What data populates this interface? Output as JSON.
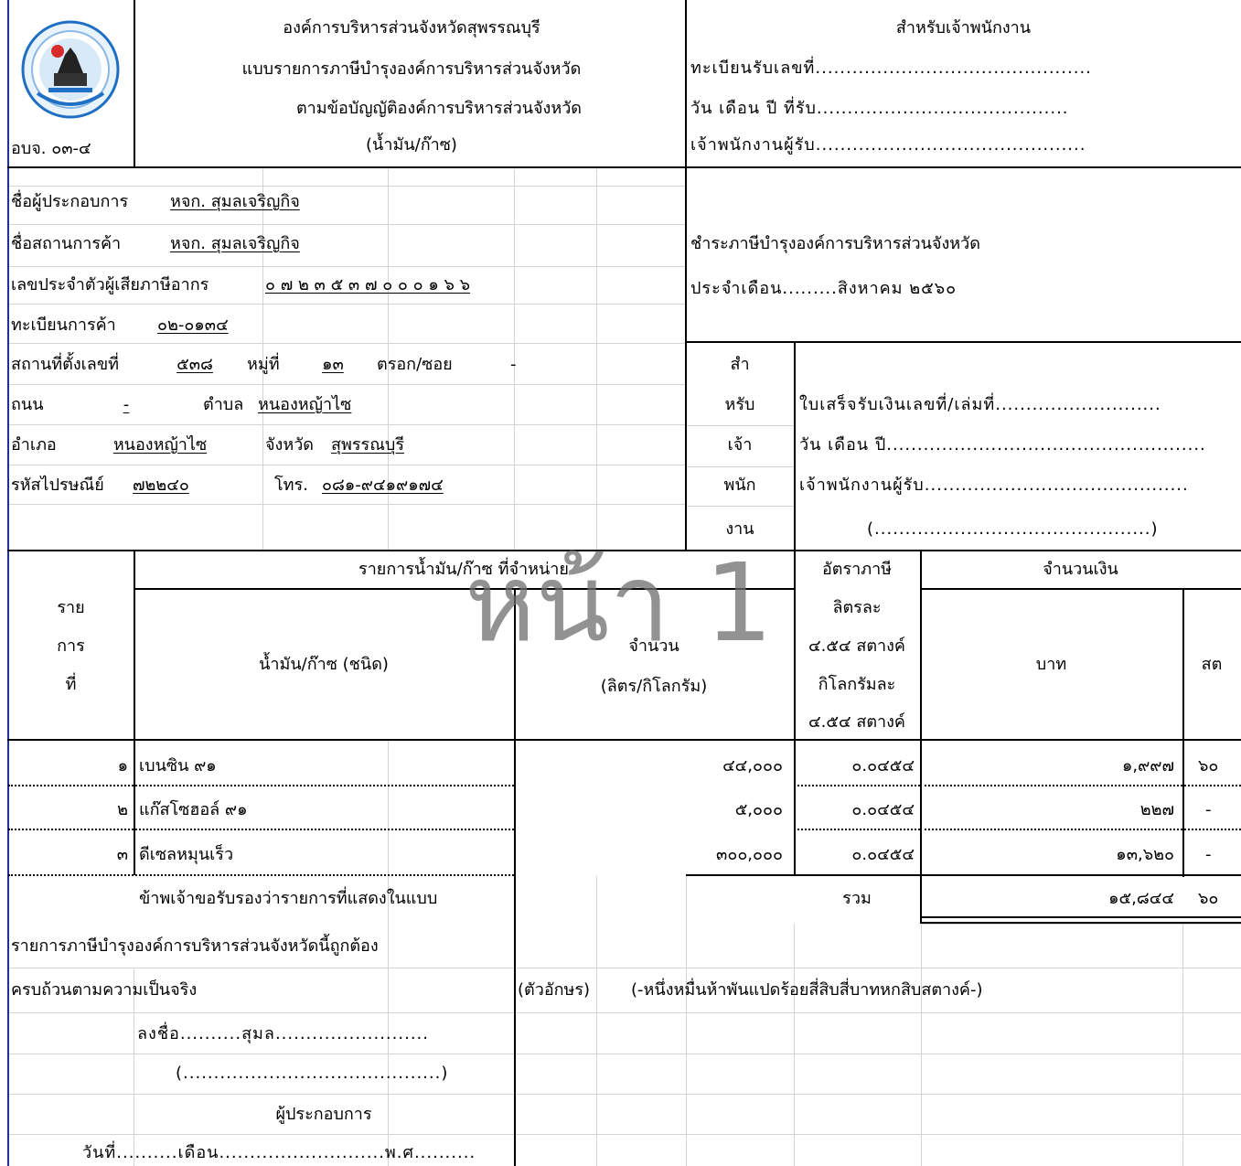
{
  "header": {
    "org_name": "องค์การบริหารส่วนจังหวัดสุพรรณบุรี",
    "form_title": "แบบรายการภาษีบำรุงองค์การบริหารส่วนจังหวัด",
    "form_subtitle": "ตามข้อบัญญัติองค์การบริหารส่วนจังหวัด",
    "form_type": "(น้ำมัน/ก๊าซ)",
    "form_code": "อบจ. ๐๓-๔"
  },
  "officer_box": {
    "title": "สำหรับเจ้าพนักงาน",
    "reg_no": "ทะเบียนรับเลขที่.............................................",
    "date_received": "วัน เดือน ปี ที่รับ.........................................",
    "officer": "เจ้าพนักงานผู้รับ............................................"
  },
  "operator": {
    "name_label": "ชื่อผู้ประกอบการ",
    "name_value": "หจก. สุมลเจริญกิจ",
    "shop_label": "ชื่อสถานการค้า",
    "shop_value": "หจก. สุมลเจริญกิจ",
    "tax_id_label": "เลขประจำตัวผู้เสียภาษีอากร",
    "tax_id_value": "๐ ๗ ๒ ๓ ๕ ๓ ๗ ๐ ๐ ๐ ๑ ๖ ๖",
    "trade_reg_label": "ทะเบียนการค้า",
    "trade_reg_value": "๐๒-๐๑๓๔",
    "address_no_label": "สถานที่ตั้งเลขที่",
    "address_no_value": "๕๓๘",
    "moo_label": "หมู่ที่",
    "moo_value": "๑๓",
    "soi_label": "ตรอก/ซอย",
    "soi_value": "-",
    "road_label": "ถนน",
    "road_value": "-",
    "tambon_label": "ตำบล",
    "tambon_value": "หนองหญ้าไซ",
    "amphoe_label": "อำเภอ",
    "amphoe_value": "หนองหญ้าไซ",
    "province_label": "จังหวัด",
    "province_value": "สุพรรณบุรี",
    "postcode_label": "รหัสไปรษณีย์",
    "postcode_value": "๗๒๒๔๐",
    "phone_label": "โทร.",
    "phone_value": "๐๘๑-๙๔๑๙๑๗๔"
  },
  "payment": {
    "line1": "ชำระภาษีบำรุงองค์การบริหารส่วนจังหวัด",
    "month_line": "ประจำเดือน.........สิงหาคม ๒๕๖๐"
  },
  "officer_side": {
    "vertical": [
      "สำ",
      "หรับ",
      "เจ้า",
      "พนัก",
      "งาน"
    ],
    "receipt": "ใบเสร็จรับเงินเลขที่/เล่มที่...........................",
    "date": "วัน เดือน ปี....................................................",
    "officer": "เจ้าพนักงานผู้รับ...........................................",
    "signature": "(.............................................)"
  },
  "table": {
    "group_header": "รายการน้ำมัน/ก๊าซ ที่จำหน่าย",
    "col_item": [
      "ราย",
      "การ",
      "ที่"
    ],
    "col_type": "น้ำมัน/ก๊าซ (ชนิด)",
    "col_qty": [
      "จำนวน",
      "(ลิตร/กิโลกรัม)"
    ],
    "col_rate": [
      "อัตราภาษี",
      "ลิตรละ",
      "๔.๕๔ สตางค์",
      "กิโลกรัมละ",
      "๔.๕๔ สตางค์"
    ],
    "col_amount": "จำนวนเงิน",
    "col_baht": "บาท",
    "col_satang": "สต",
    "rows": [
      {
        "no": "๑",
        "type": "เบนซิน ๙๑",
        "qty": "๔๔,๐๐๐",
        "rate": "๐.๐๔๕๔",
        "baht": "๑,๙๙๗",
        "satang": "๖๐"
      },
      {
        "no": "๒",
        "type": "แก๊สโซฮอล์ ๙๑",
        "qty": "๕,๐๐๐",
        "rate": "๐.๐๔๕๔",
        "baht": "๒๒๗",
        "satang": "-"
      },
      {
        "no": "๓",
        "type": "ดีเซลหมุนเร็ว",
        "qty": "๓๐๐,๐๐๐",
        "rate": "๐.๐๔๕๔",
        "baht": "๑๓,๖๒๐",
        "satang": "-"
      }
    ],
    "total_label": "รวม",
    "total_baht": "๑๕,๘๔๔",
    "total_satang": "๖๐"
  },
  "certification": {
    "line1": "ข้าพเจ้าขอรับรองว่ารายการที่แสดงในแบบ",
    "line2": "รายการภาษีบำรุงองค์การบริหารส่วนจังหวัดนี้ถูกต้อง",
    "line3": "ครบถ้วนตามความเป็นจริง",
    "words_label": "(ตัวอักษร)",
    "words_value": "(-หนึ่งหมื่นห้าพันแปดร้อยสี่สิบสี่บาทหกสิบสตางค์-)",
    "sign": "ลงชื่อ..........สุมล.........................",
    "sign_paren": "(..........................................)",
    "role": "ผู้ประกอบการ",
    "date": "วันที่..........เดือน...........................พ.ศ.........."
  },
  "watermark": "หน้า 1",
  "colors": {
    "grid": "#d4d4d4",
    "border": "#000000",
    "watermark": "#6e6e6e",
    "seal_blue": "#1f6fc4"
  }
}
